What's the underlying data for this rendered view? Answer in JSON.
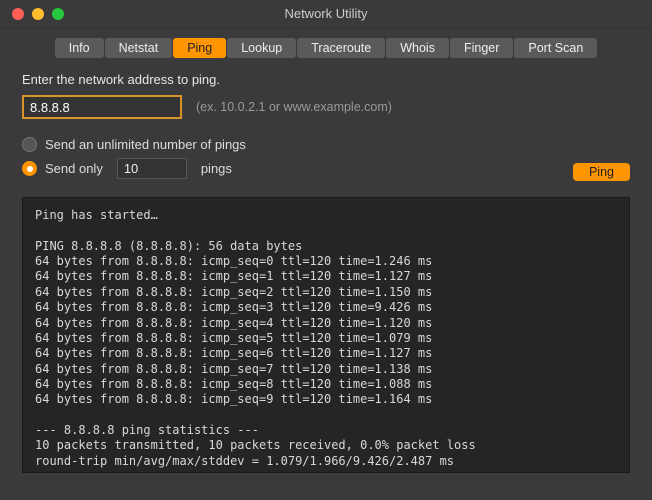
{
  "window": {
    "title": "Network Utility"
  },
  "tabs": [
    {
      "label": "Info",
      "active": false
    },
    {
      "label": "Netstat",
      "active": false
    },
    {
      "label": "Ping",
      "active": true
    },
    {
      "label": "Lookup",
      "active": false
    },
    {
      "label": "Traceroute",
      "active": false
    },
    {
      "label": "Whois",
      "active": false
    },
    {
      "label": "Finger",
      "active": false
    },
    {
      "label": "Port Scan",
      "active": false
    }
  ],
  "form": {
    "prompt": "Enter the network address to ping.",
    "address_value": "8.8.8.8",
    "hint": "(ex. 10.0.2.1 or www.example.com)",
    "option_unlimited": "Send an unlimited number of pings",
    "option_sendonly_prefix": "Send only",
    "option_sendonly_suffix": "pings",
    "count_value": "10",
    "selected_option": "sendonly",
    "button": "Ping"
  },
  "output": {
    "lines": [
      "Ping has started…",
      "",
      "PING 8.8.8.8 (8.8.8.8): 56 data bytes",
      "64 bytes from 8.8.8.8: icmp_seq=0 ttl=120 time=1.246 ms",
      "64 bytes from 8.8.8.8: icmp_seq=1 ttl=120 time=1.127 ms",
      "64 bytes from 8.8.8.8: icmp_seq=2 ttl=120 time=1.150 ms",
      "64 bytes from 8.8.8.8: icmp_seq=3 ttl=120 time=9.426 ms",
      "64 bytes from 8.8.8.8: icmp_seq=4 ttl=120 time=1.120 ms",
      "64 bytes from 8.8.8.8: icmp_seq=5 ttl=120 time=1.079 ms",
      "64 bytes from 8.8.8.8: icmp_seq=6 ttl=120 time=1.127 ms",
      "64 bytes from 8.8.8.8: icmp_seq=7 ttl=120 time=1.138 ms",
      "64 bytes from 8.8.8.8: icmp_seq=8 ttl=120 time=1.088 ms",
      "64 bytes from 8.8.8.8: icmp_seq=9 ttl=120 time=1.164 ms",
      "",
      "--- 8.8.8.8 ping statistics ---",
      "10 packets transmitted, 10 packets received, 0.0% packet loss",
      "round-trip min/avg/max/stddev = 1.079/1.966/9.426/2.487 ms"
    ]
  }
}
